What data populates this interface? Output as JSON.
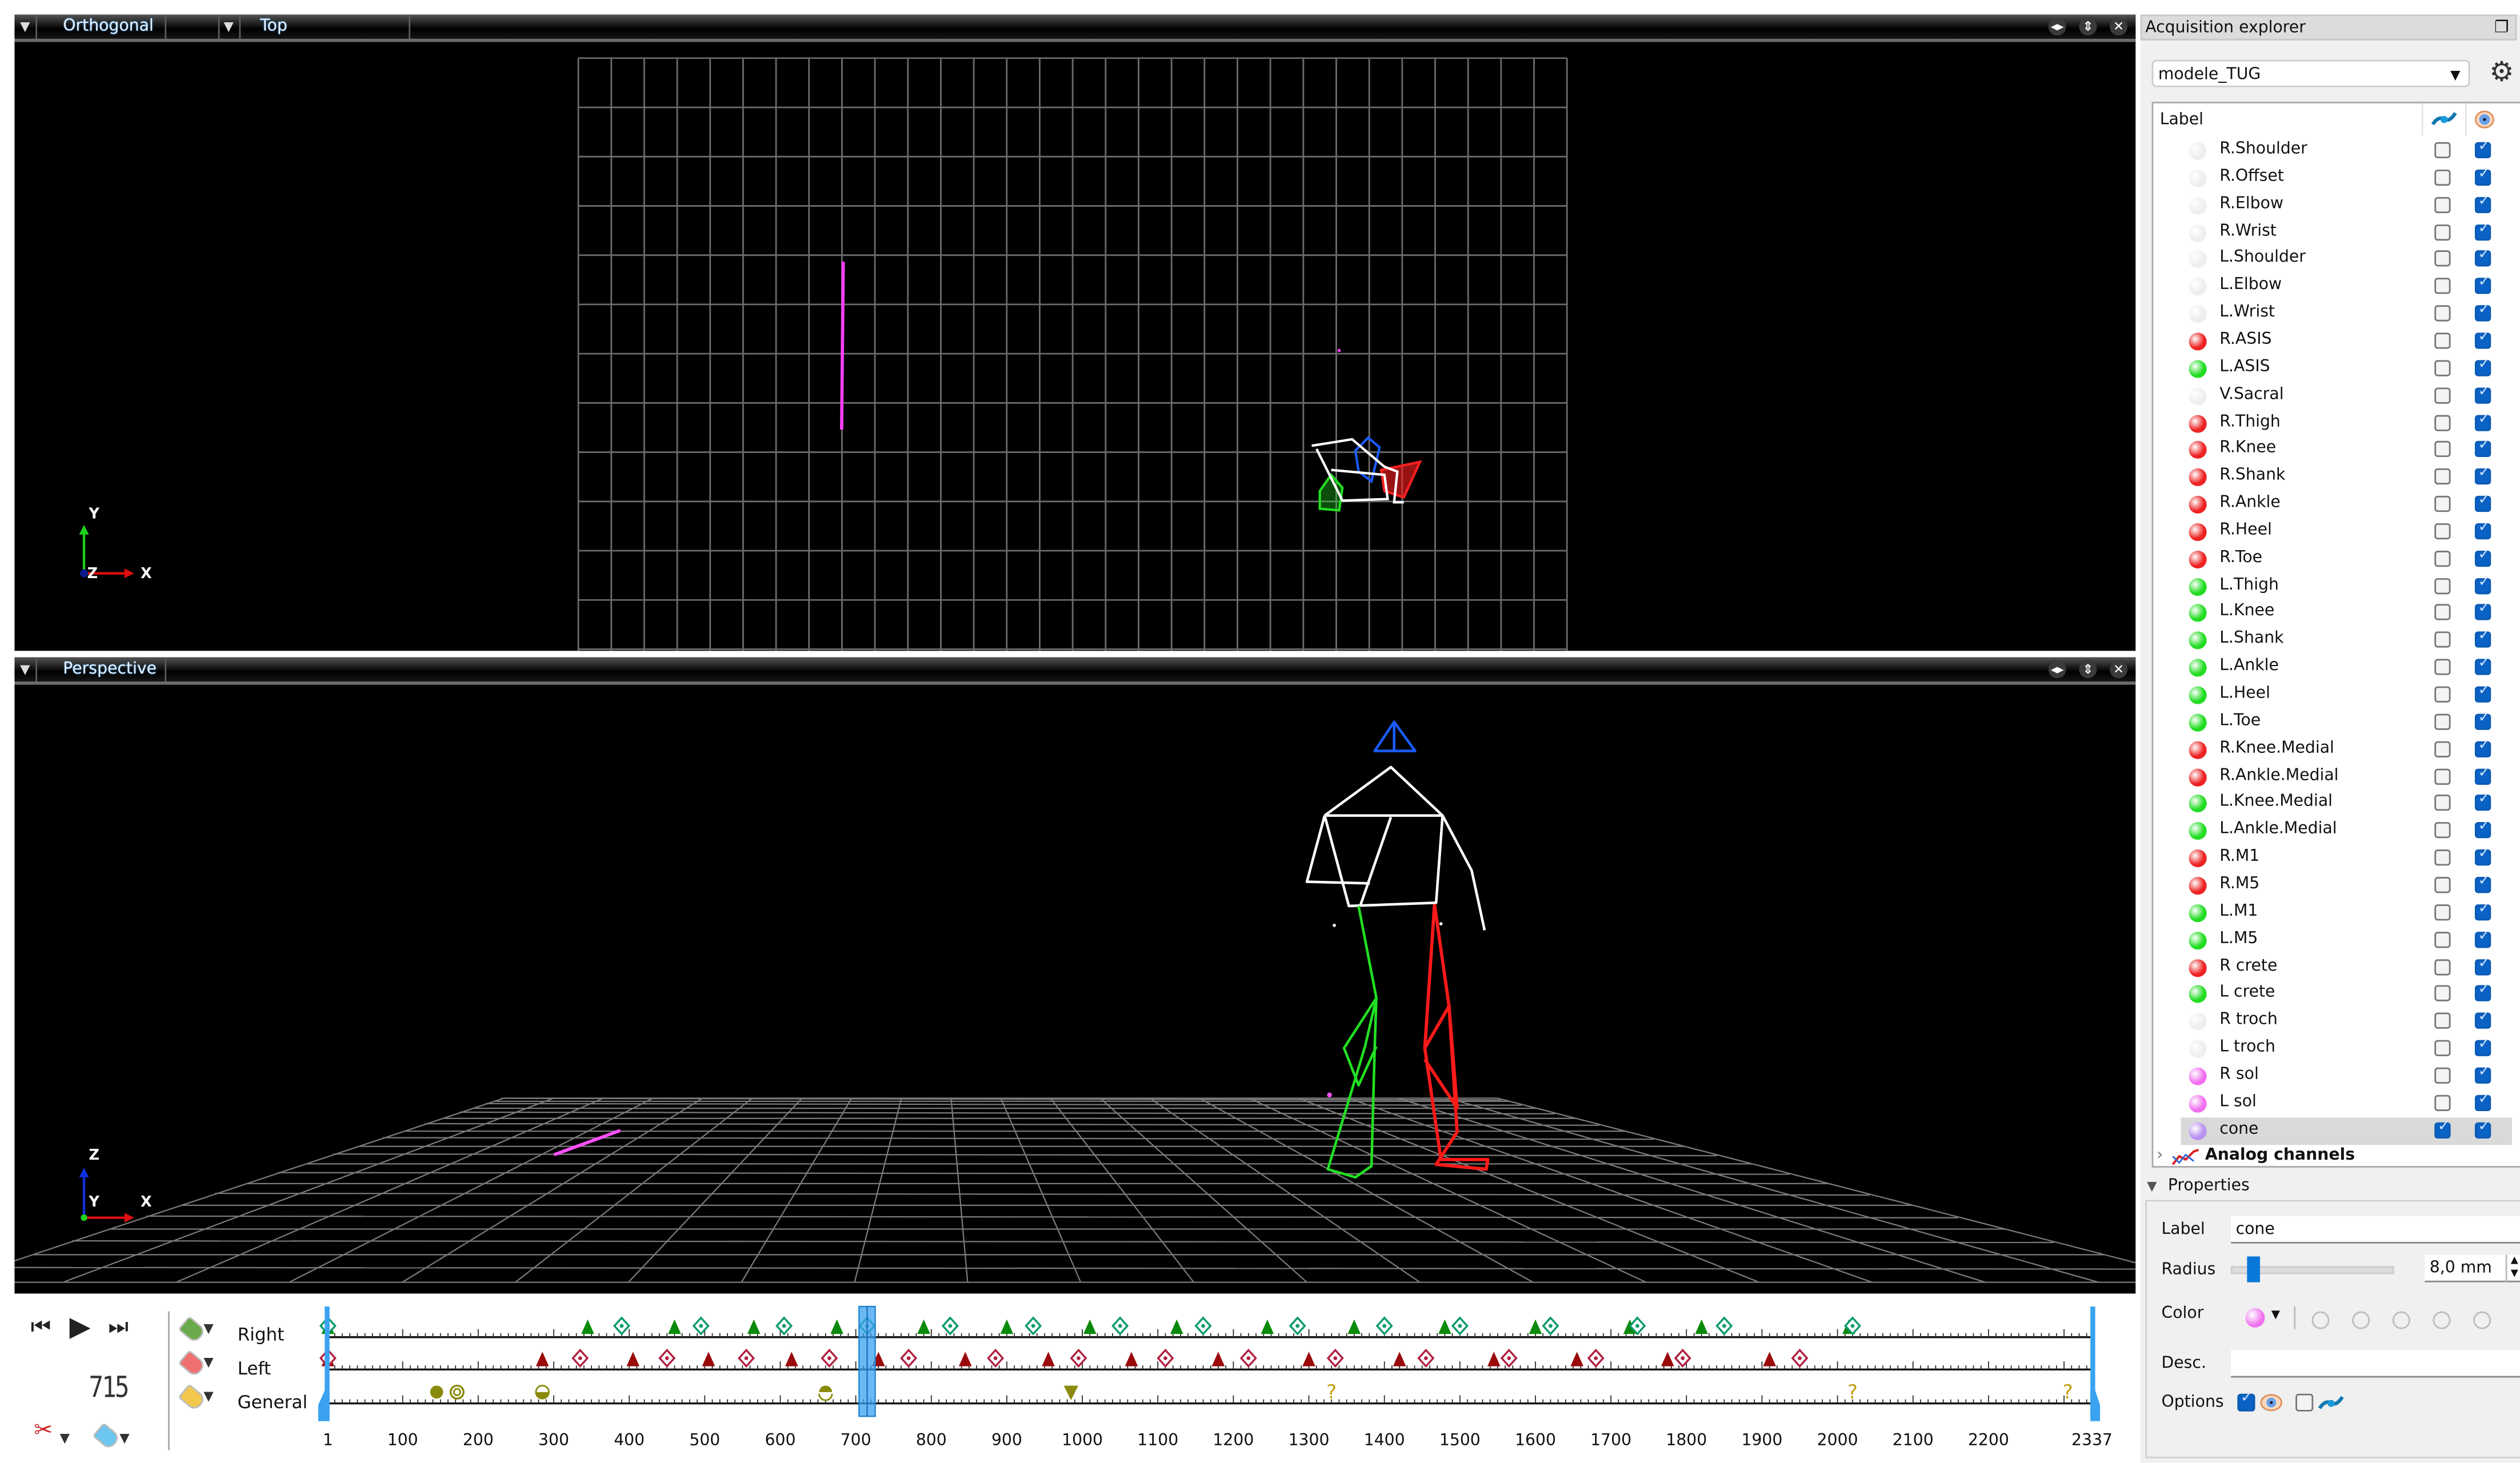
{
  "viewports": {
    "top": {
      "projection": "Orthogonal",
      "view": "Top",
      "axes": {
        "x": "X",
        "y": "Y",
        "z": "Z"
      }
    },
    "perspective": {
      "projection": "Perspective",
      "axes": {
        "x": "X",
        "y": "Y",
        "z": "Z"
      }
    },
    "controls": {
      "expand_h": "◂▸",
      "expand_v": "⇕",
      "close": "✕"
    }
  },
  "timeline": {
    "current_frame": "715",
    "first_frame": 1,
    "last_frame": 2337,
    "tick_labels": [
      "1",
      "100",
      "200",
      "300",
      "400",
      "500",
      "600",
      "700",
      "800",
      "900",
      "1000",
      "1100",
      "1200",
      "1300",
      "1400",
      "1500",
      "1600",
      "1700",
      "1800",
      "1900",
      "2000",
      "2100",
      "2200",
      "2337"
    ],
    "tracks": [
      {
        "name": "Right",
        "tag_color": "#6aaa4a"
      },
      {
        "name": "Left",
        "tag_color": "#f07070"
      },
      {
        "name": "General",
        "tag_color": "#f2c94c"
      }
    ],
    "events": {
      "right_foot_strike": [
        1,
        345,
        460,
        565,
        675,
        790,
        900,
        1010,
        1125,
        1245,
        1360,
        1480,
        1600,
        1725,
        1820,
        2015
      ],
      "right_foot_off": [
        1,
        390,
        495,
        605,
        715,
        825,
        935,
        1050,
        1160,
        1285,
        1400,
        1500,
        1620,
        1735,
        1850,
        2020
      ],
      "left_foot_strike": [
        1,
        285,
        405,
        505,
        615,
        730,
        845,
        955,
        1065,
        1180,
        1300,
        1420,
        1545,
        1655,
        1775,
        1910
      ],
      "left_foot_off": [
        1,
        335,
        450,
        555,
        665,
        770,
        885,
        995,
        1110,
        1220,
        1335,
        1455,
        1565,
        1680,
        1795,
        1950
      ],
      "general": [
        {
          "frame": 145,
          "type": "filled-circle"
        },
        {
          "frame": 172,
          "type": "ring"
        },
        {
          "frame": 285,
          "type": "half-bottom"
        },
        {
          "frame": 660,
          "type": "half-top"
        },
        {
          "frame": 985,
          "type": "down-triangle"
        },
        {
          "frame": 1330,
          "type": "unknown"
        },
        {
          "frame": 2020,
          "type": "unknown"
        },
        {
          "frame": 2305,
          "type": "unknown"
        }
      ]
    },
    "colors": {
      "right": "#0a8a0a",
      "left": "#9a0a0a",
      "general": "#8a8a0a",
      "cursor": "#3aa2f0"
    }
  },
  "explorer": {
    "title": "Acquisition explorer",
    "model": "modele_TUG",
    "tree_header": "Label",
    "markers": [
      {
        "label": "R.Shoulder",
        "color": "#eeeeee",
        "trajectory": false,
        "visible": true
      },
      {
        "label": "R.Offset",
        "color": "#eeeeee",
        "trajectory": false,
        "visible": true
      },
      {
        "label": "R.Elbow",
        "color": "#eeeeee",
        "trajectory": false,
        "visible": true
      },
      {
        "label": "R.Wrist",
        "color": "#eeeeee",
        "trajectory": false,
        "visible": true
      },
      {
        "label": "L.Shoulder",
        "color": "#eeeeee",
        "trajectory": false,
        "visible": true
      },
      {
        "label": "L.Elbow",
        "color": "#eeeeee",
        "trajectory": false,
        "visible": true
      },
      {
        "label": "L.Wrist",
        "color": "#eeeeee",
        "trajectory": false,
        "visible": true
      },
      {
        "label": "R.ASIS",
        "color": "#ee2222",
        "trajectory": false,
        "visible": true
      },
      {
        "label": "L.ASIS",
        "color": "#22dd22",
        "trajectory": false,
        "visible": true
      },
      {
        "label": "V.Sacral",
        "color": "#eeeeee",
        "trajectory": false,
        "visible": true
      },
      {
        "label": "R.Thigh",
        "color": "#ee2222",
        "trajectory": false,
        "visible": true
      },
      {
        "label": "R.Knee",
        "color": "#ee2222",
        "trajectory": false,
        "visible": true
      },
      {
        "label": "R.Shank",
        "color": "#ee2222",
        "trajectory": false,
        "visible": true
      },
      {
        "label": "R.Ankle",
        "color": "#ee2222",
        "trajectory": false,
        "visible": true
      },
      {
        "label": "R.Heel",
        "color": "#ee2222",
        "trajectory": false,
        "visible": true
      },
      {
        "label": "R.Toe",
        "color": "#ee2222",
        "trajectory": false,
        "visible": true
      },
      {
        "label": "L.Thigh",
        "color": "#22dd22",
        "trajectory": false,
        "visible": true
      },
      {
        "label": "L.Knee",
        "color": "#22dd22",
        "trajectory": false,
        "visible": true
      },
      {
        "label": "L.Shank",
        "color": "#22dd22",
        "trajectory": false,
        "visible": true
      },
      {
        "label": "L.Ankle",
        "color": "#22dd22",
        "trajectory": false,
        "visible": true
      },
      {
        "label": "L.Heel",
        "color": "#22dd22",
        "trajectory": false,
        "visible": true
      },
      {
        "label": "L.Toe",
        "color": "#22dd22",
        "trajectory": false,
        "visible": true
      },
      {
        "label": "R.Knee.Medial",
        "color": "#ee2222",
        "trajectory": false,
        "visible": true
      },
      {
        "label": "R.Ankle.Medial",
        "color": "#ee2222",
        "trajectory": false,
        "visible": true
      },
      {
        "label": "L.Knee.Medial",
        "color": "#22dd22",
        "trajectory": false,
        "visible": true
      },
      {
        "label": "L.Ankle.Medial",
        "color": "#22dd22",
        "trajectory": false,
        "visible": true
      },
      {
        "label": "R.M1",
        "color": "#ee2222",
        "trajectory": false,
        "visible": true
      },
      {
        "label": "R.M5",
        "color": "#ee2222",
        "trajectory": false,
        "visible": true
      },
      {
        "label": "L.M1",
        "color": "#22dd22",
        "trajectory": false,
        "visible": true
      },
      {
        "label": "L.M5",
        "color": "#22dd22",
        "trajectory": false,
        "visible": true
      },
      {
        "label": "R crete",
        "color": "#ee2222",
        "trajectory": false,
        "visible": true
      },
      {
        "label": "L crete",
        "color": "#22dd22",
        "trajectory": false,
        "visible": true
      },
      {
        "label": "R troch",
        "color": "#eeeeee",
        "trajectory": false,
        "visible": true
      },
      {
        "label": "L troch",
        "color": "#eeeeee",
        "trajectory": false,
        "visible": true
      },
      {
        "label": "R sol",
        "color": "#f070f0",
        "trajectory": false,
        "visible": true
      },
      {
        "label": "L sol",
        "color": "#f070f0",
        "trajectory": false,
        "visible": true
      },
      {
        "label": "cone",
        "color": "#b890f0",
        "trajectory": true,
        "visible": true,
        "selected": true
      }
    ],
    "analog_group": "Analog channels",
    "properties": {
      "header": "Properties",
      "label_caption": "Label",
      "label_value": "cone",
      "radius_caption": "Radius",
      "radius_value": "8,0 mm",
      "radius_slider_fraction": 0.1,
      "color_caption": "Color",
      "color_value": "#f070f0",
      "desc_caption": "Desc.",
      "desc_value": "",
      "options_caption": "Options",
      "options_visible": true,
      "options_trajectory": false
    }
  }
}
